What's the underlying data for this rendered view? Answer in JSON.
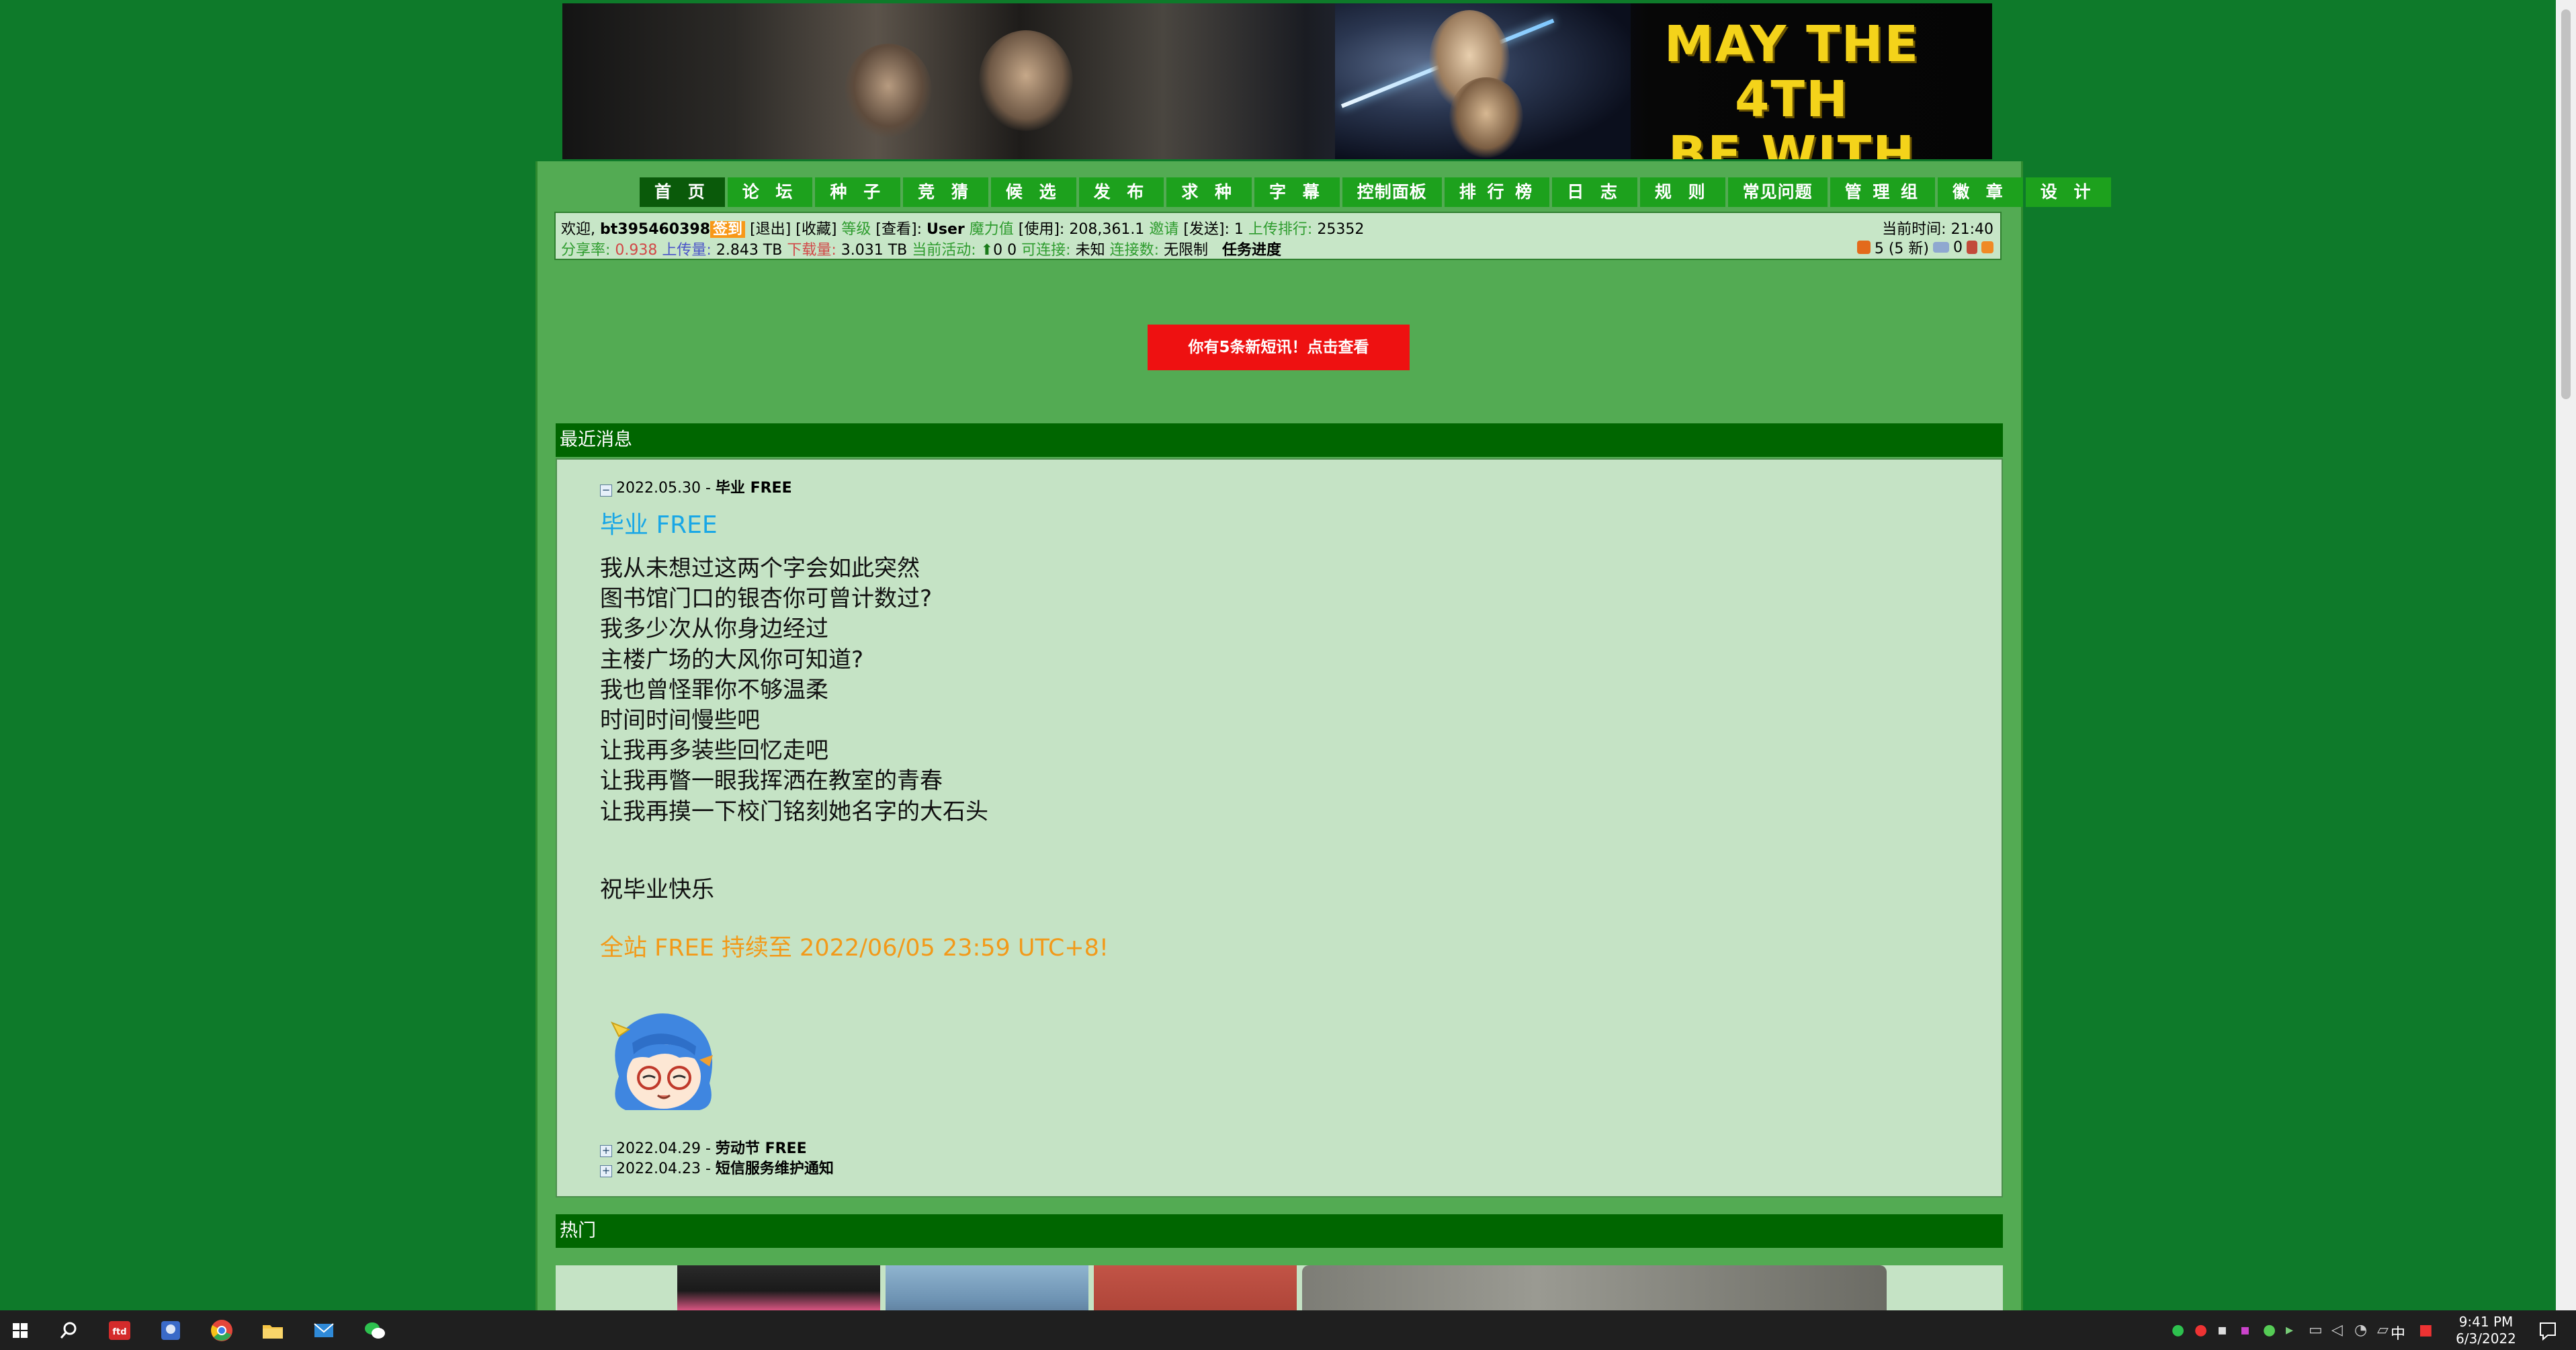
{
  "banner": {
    "slogan_line1": "MAY THE 4TH",
    "slogan_line2": "BE WITH YOU"
  },
  "nav": {
    "items": [
      {
        "label": "首 页",
        "active": true
      },
      {
        "label": "论 坛"
      },
      {
        "label": "种 子"
      },
      {
        "label": "竞 猜"
      },
      {
        "label": "候 选"
      },
      {
        "label": "发 布"
      },
      {
        "label": "求 种"
      },
      {
        "label": "字 幕"
      },
      {
        "label": "控制面板"
      },
      {
        "label": "排 行 榜"
      },
      {
        "label": "日 志"
      },
      {
        "label": "规 则"
      },
      {
        "label": "常见问题"
      },
      {
        "label": "管 理 组"
      },
      {
        "label": "徽 章"
      },
      {
        "label": "设 计"
      }
    ]
  },
  "userbar": {
    "welcome": "欢迎,",
    "username": "bt395460398",
    "checkin": "签到",
    "logout": "[退出]",
    "favorites": "[收藏]",
    "level_label": "等级",
    "view": "[查看]:",
    "level_value": "User",
    "magic_label": "魔力值",
    "magic_value": "[使用]: 208,361.1",
    "invite_label": "邀请",
    "invite_value": "[发送]: 1",
    "upload_rank_label": "上传排行:",
    "upload_rank_value": "25352",
    "time_label": "当前时间:",
    "time_value": "21:40",
    "ratio_label": "分享率:",
    "ratio_value": "0.938",
    "uploaded_label": "上传量:",
    "uploaded_value": "2.843 TB",
    "downloaded_label": "下载量:",
    "downloaded_value": "3.031 TB",
    "activity_label": "当前活动:",
    "activity_value": "0  0",
    "connectable_label": "可连接:",
    "connectable_value": "未知",
    "connections_label": "连接数:",
    "connections_value": "无限制",
    "task_label": "任务进度",
    "messages_value": "5 (5 新)",
    "other_value": "0"
  },
  "alert": {
    "text": "你有5条新短讯！点击查看"
  },
  "news": {
    "section_title": "最近消息",
    "entries": [
      {
        "date": "2022.05.30 -",
        "title": "毕业 FREE"
      },
      {
        "date": "2022.04.29 -",
        "title": "劳动节 FREE"
      },
      {
        "date": "2022.04.23 -",
        "title": "短信服务维护通知"
      }
    ],
    "body_title": "毕业 FREE",
    "poem": [
      "我从未想过这两个字会如此突然",
      "图书馆门口的银杏你可曾计数过?",
      "我多少次从你身边经过",
      "主楼广场的大风你可知道?",
      "我也曾怪罪你不够温柔",
      "时间时间慢些吧",
      "让我再多装些回忆走吧",
      "让我再瞥一眼我挥洒在教室的青春",
      "让我再摸一下校门铭刻她名字的大石头"
    ],
    "blessing": "祝毕业快乐",
    "free_notice": "全站 FREE 持续至 2022/06/05 23:59 UTC+8!"
  },
  "hot": {
    "section_title": "热门"
  },
  "taskbar": {
    "time": "9:41 PM",
    "date": "6/3/2022",
    "ime": "中"
  },
  "colors": {
    "page_bg": "#0e7a2a",
    "panel_bg": "#53ab53",
    "nav_bg": "#1da11d",
    "nav_active": "#0a5a0a",
    "section_header": "#006600",
    "content_bg": "#c5e3c5",
    "alert": "#ee1111",
    "free_notice": "#f29a1a",
    "news_title": "#19a7e6"
  }
}
